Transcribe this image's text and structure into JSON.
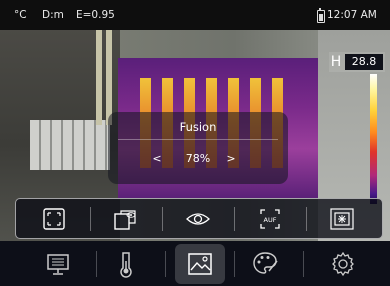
{
  "status": {
    "unit": "°C",
    "distance": "D:m",
    "emissivity": "E=0.95",
    "time": "12:07 AM",
    "battery_icon": "battery-icon"
  },
  "scale": {
    "mode_letter": "H",
    "max_temp": "28.8"
  },
  "popup": {
    "title": "Fusion",
    "prev_arrow": "<",
    "value": "78%",
    "next_arrow": ">"
  },
  "toolbar": {
    "tools": [
      {
        "name": "full-screen-ir-icon"
      },
      {
        "name": "picture-in-picture-icon"
      },
      {
        "name": "visible-eye-icon"
      },
      {
        "name": "auto-focus-icon"
      },
      {
        "name": "fusion-blend-icon"
      }
    ]
  },
  "menu": {
    "items": [
      {
        "name": "display-icon",
        "active": false
      },
      {
        "name": "thermometer-icon",
        "active": false
      },
      {
        "name": "image-mode-icon",
        "active": true
      },
      {
        "name": "palette-icon",
        "active": false
      },
      {
        "name": "settings-gear-icon",
        "active": false
      }
    ]
  },
  "colors": {
    "accent": "#ffffff",
    "popup_bg": "#12141e",
    "menubar_bg": "#0d0f18"
  }
}
